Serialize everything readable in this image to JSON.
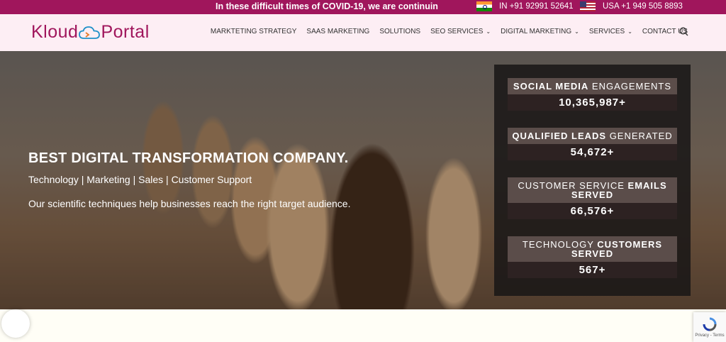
{
  "topbar": {
    "announcement": "In these difficult times of COVID-19, we are continuin",
    "phone_in": "IN +91 92991 52641",
    "phone_us": "USA +1 949 505 8893"
  },
  "logo": {
    "part1": "Kloud",
    "part2": "Portal"
  },
  "nav": {
    "items": [
      {
        "label": "MARKTETING STRATEGY"
      },
      {
        "label": "SAAS MARKETING"
      },
      {
        "label": "SOLUTIONS"
      },
      {
        "label": "SEO SERVICES"
      },
      {
        "label": "DIGITAL MARKETING"
      },
      {
        "label": "SERVICES"
      },
      {
        "label": "CONTACT US"
      }
    ]
  },
  "hero": {
    "title": "BEST DIGITAL TRANSFORMATION COMPANY.",
    "subtitle": "Technology | Marketing | Sales | Customer Support",
    "description": "Our scientific techniques help businesses reach the right target audience."
  },
  "stats": [
    {
      "label_a": "SOCIAL MEDIA",
      "label_b": " ENGAGEMENTS",
      "value": "10,365,987+"
    },
    {
      "label_a": "QUALIFIED LEADS",
      "label_b": " GENERATED",
      "value": "54,672+"
    },
    {
      "label_a": "CUSTOMER SERVICE ",
      "label_b": "EMAILS SERVED",
      "value": "66,576+"
    },
    {
      "label_a": "TECHNOLOGY ",
      "label_b": "CUSTOMERS SERVED",
      "value": "567+"
    }
  ],
  "recaptcha": {
    "text": "Privacy - Terms"
  },
  "colors": {
    "brand": "#a0165c",
    "header_bg": "#fdeef4",
    "stat_label_bg": "#5b4d4a"
  }
}
